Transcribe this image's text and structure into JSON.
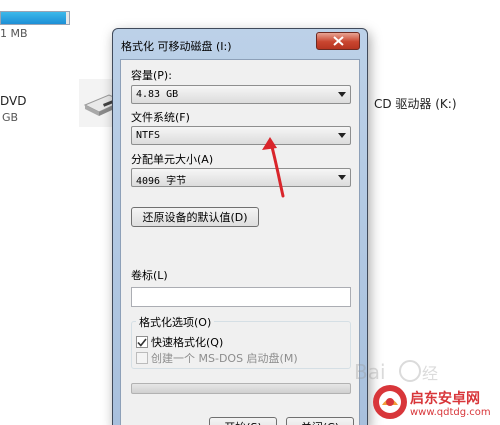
{
  "background": {
    "drive_size_text": "1 MB",
    "dvd_label": "DVD",
    "dvd_size_text": "GB",
    "cd_drive_label": "CD 驱动器 (K:)",
    "usage_bar_fraction": 0.95
  },
  "dialog": {
    "title": "格式化 可移动磁盘 (I:)",
    "close_icon": "close-x-icon",
    "capacity": {
      "label": "容量(P):",
      "value": "4.83 GB"
    },
    "filesystem": {
      "label": "文件系统(F)",
      "value": "NTFS"
    },
    "allocation": {
      "label": "分配单元大小(A)",
      "value": "4096 字节"
    },
    "restore_button": "还原设备的默认值(D)",
    "volume_label": {
      "label": "卷标(L)",
      "value": ""
    },
    "format_options": {
      "title": "格式化选项(O)",
      "quick_format": {
        "label": "快速格式化(Q)",
        "checked": true,
        "enabled": true
      },
      "msdos_startup": {
        "label": "创建一个 MS-DOS 启动盘(M)",
        "checked": false,
        "enabled": false
      }
    },
    "progress_fraction": 0,
    "start_button": "开始(S)",
    "close_button": "关闭(C)"
  },
  "colors": {
    "annotation_arrow": "#d9252b",
    "watermark": "#d8363a"
  },
  "watermark": {
    "brand_text": "启东安卓网",
    "url_text": "www.qdtdg.com",
    "baidu_text": "Baidu 经验"
  }
}
